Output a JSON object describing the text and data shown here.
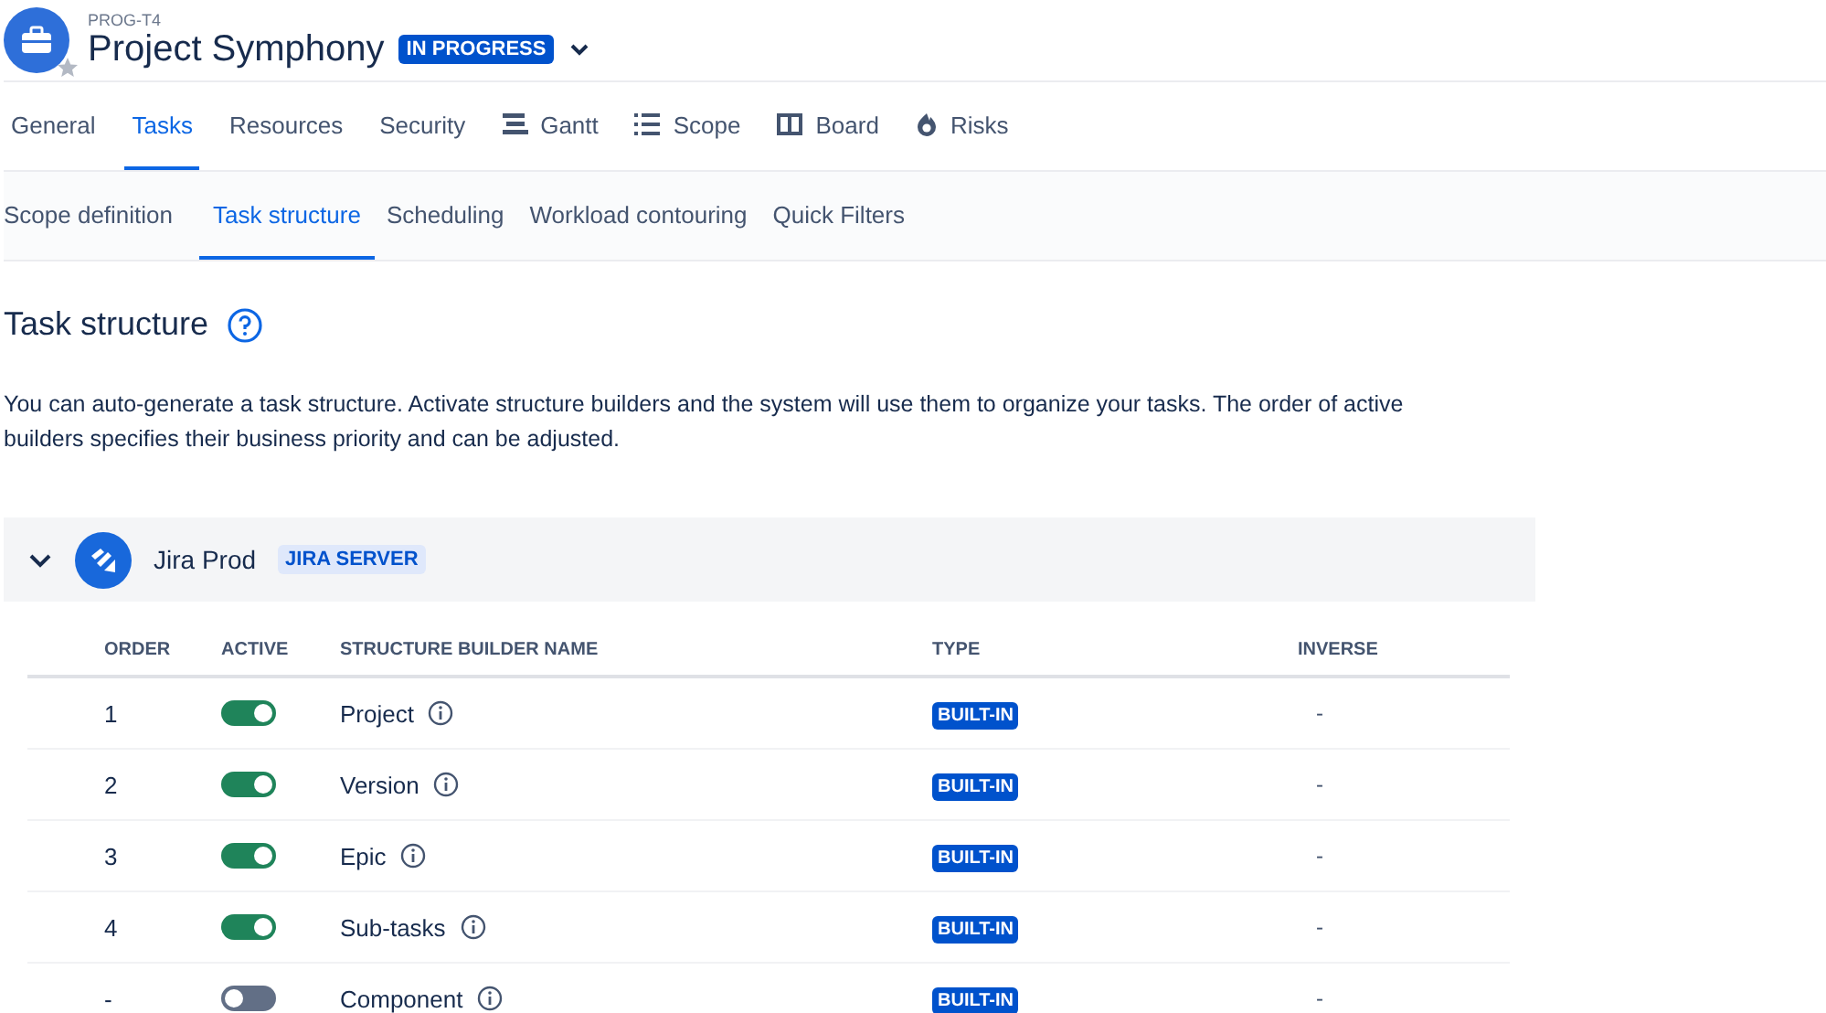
{
  "project": {
    "key": "PROG-T4",
    "name": "Project Symphony",
    "status": "IN PROGRESS",
    "starred": false
  },
  "tabs": [
    {
      "label": "General",
      "selected": false,
      "kind": "plain"
    },
    {
      "label": "Tasks",
      "selected": true,
      "kind": "plain"
    },
    {
      "label": "Resources",
      "selected": false,
      "kind": "plain"
    },
    {
      "label": "Security",
      "selected": false,
      "kind": "plain"
    },
    {
      "label": "Gantt",
      "selected": false,
      "kind": "icon"
    },
    {
      "label": "Scope",
      "selected": false,
      "kind": "icon"
    },
    {
      "label": "Board",
      "selected": false,
      "kind": "icon"
    },
    {
      "label": "Risks",
      "selected": false,
      "kind": "icon"
    }
  ],
  "subtabs": [
    {
      "label": "Scope definition",
      "selected": false
    },
    {
      "label": "Task structure",
      "selected": true
    },
    {
      "label": "Scheduling",
      "selected": false
    },
    {
      "label": "Workload contouring",
      "selected": false
    },
    {
      "label": "Quick Filters",
      "selected": false
    }
  ],
  "heading": "Task structure",
  "description": [
    "You can auto-generate a task structure. Activate structure builders and the system will use them to organize your tasks. The order of active",
    "builders specifies their business priority and can be adjusted."
  ],
  "connection": {
    "name": "Jira Prod",
    "badge": "JIRA SERVER",
    "expanded": true
  },
  "table": {
    "columns": [
      "ORDER",
      "ACTIVE",
      "STRUCTURE BUILDER NAME",
      "TYPE",
      "INVERSE"
    ],
    "rows": [
      {
        "order": "1",
        "active": true,
        "name": "Project",
        "type": "BUILT-IN",
        "inverse": "-"
      },
      {
        "order": "2",
        "active": true,
        "name": "Version",
        "type": "BUILT-IN",
        "inverse": "-"
      },
      {
        "order": "3",
        "active": true,
        "name": "Epic",
        "type": "BUILT-IN",
        "inverse": "-"
      },
      {
        "order": "4",
        "active": true,
        "name": "Sub-tasks",
        "type": "BUILT-IN",
        "inverse": "-"
      },
      {
        "order": "-",
        "active": false,
        "name": "Component",
        "type": "BUILT-IN",
        "inverse": "-"
      }
    ]
  }
}
